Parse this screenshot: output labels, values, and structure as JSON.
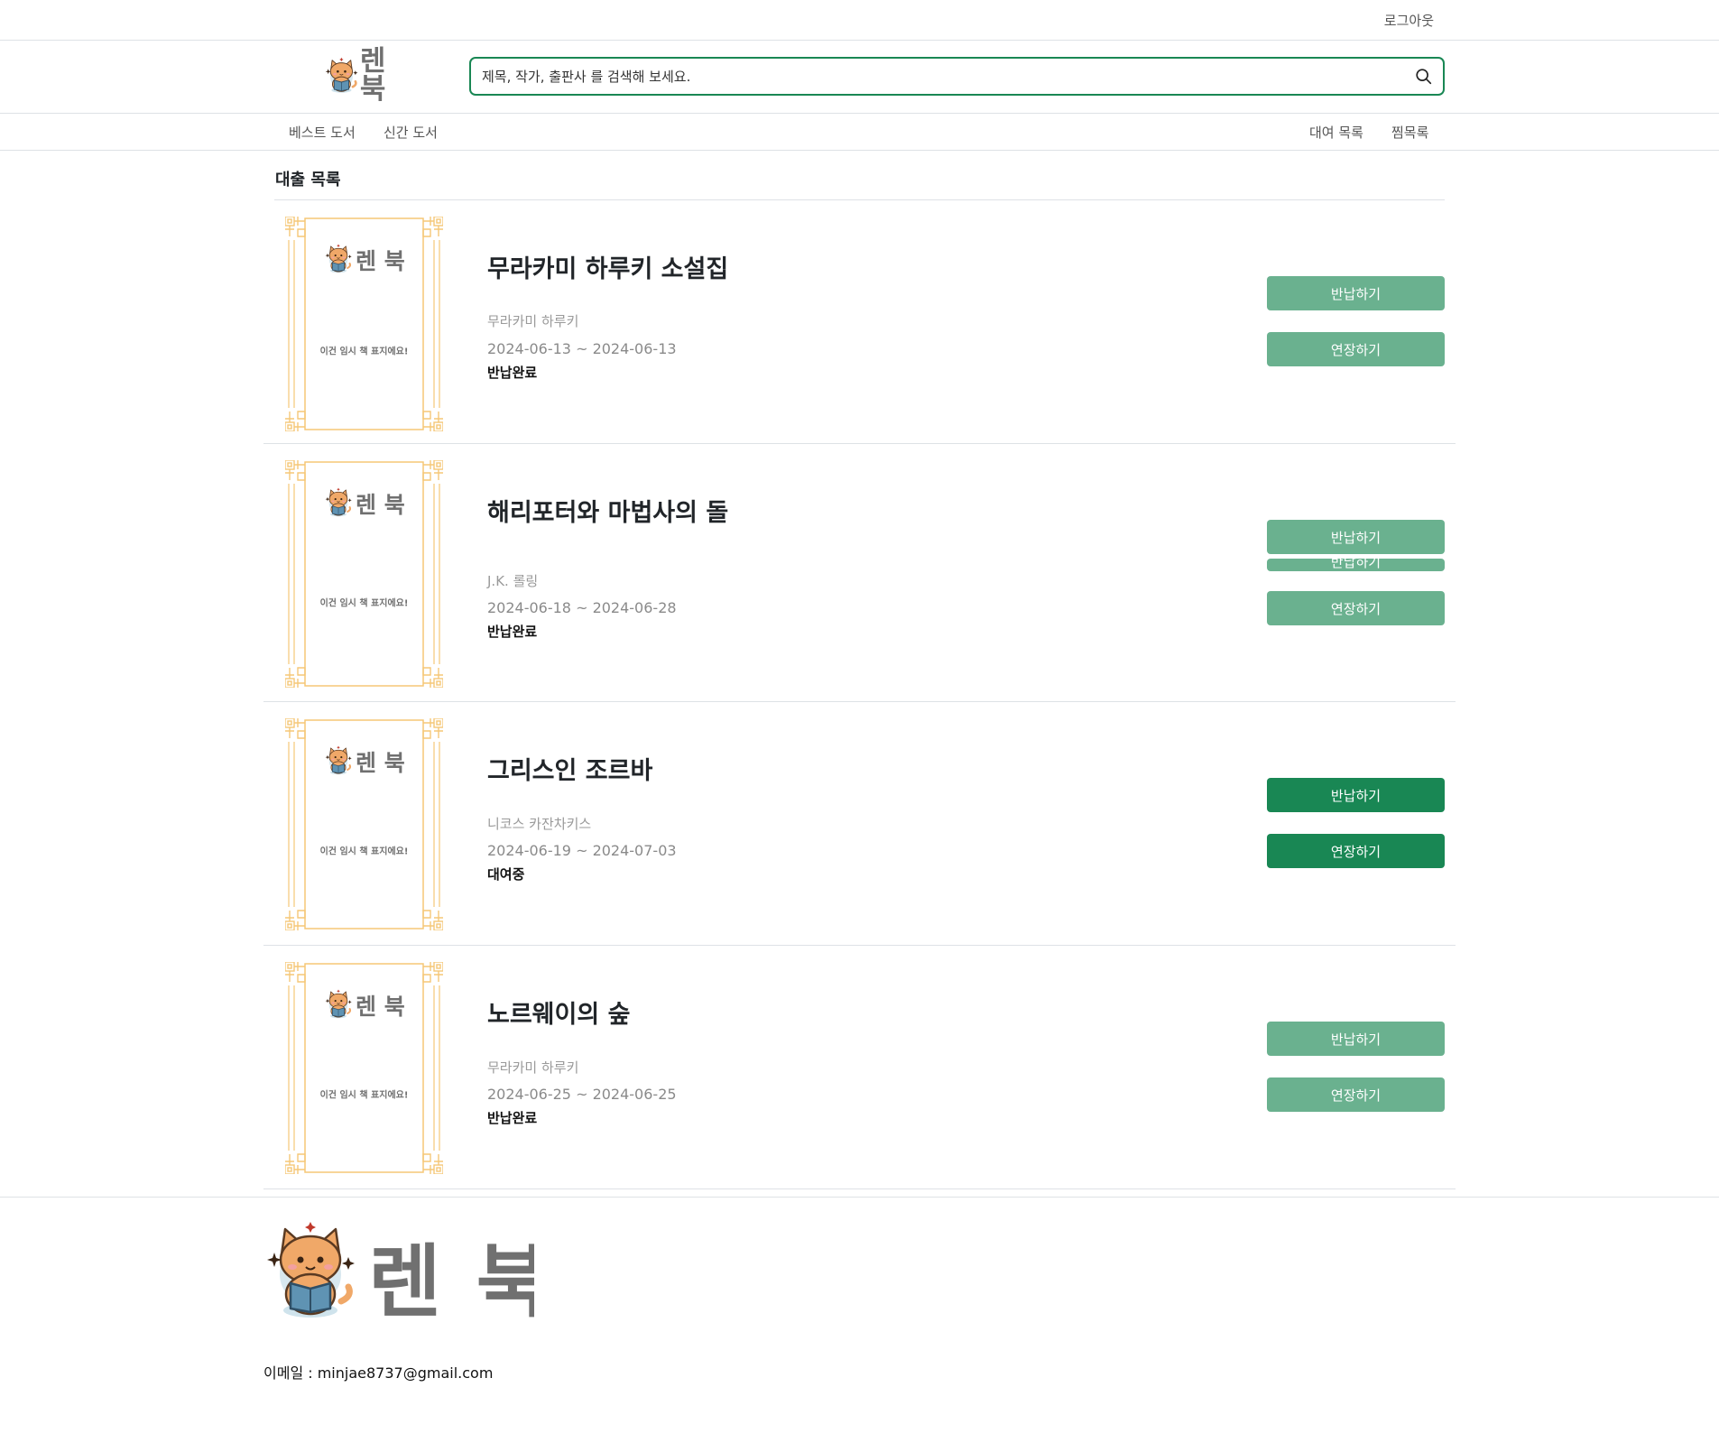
{
  "topbar": {
    "logout_label": "로그아웃"
  },
  "header": {
    "brand_text": "렌 북",
    "search": {
      "placeholder": "제목, 작가, 출판사 를 검색해 보세요.",
      "value": ""
    }
  },
  "nav": {
    "best_books": "베스트 도서",
    "new_books": "신간 도서",
    "rental_list": "대여 목록",
    "wishlist": "찜목록"
  },
  "page": {
    "title": "대출 목록"
  },
  "cover": {
    "brand_text": "렌 북",
    "caption": "이건 임시 책 표지에요!"
  },
  "loans": [
    {
      "title": "무라카미 하루키 소설집",
      "author": "무라카미 하루키",
      "dates": "2024-06-13 ~ 2024-06-13",
      "status": "반납완료",
      "return_label": "반납하기",
      "extend_label": "연장하기"
    },
    {
      "title": "해리포터와 마법사의 돌",
      "author": "J.K. 롤링",
      "dates": "2024-06-18 ~ 2024-06-28",
      "status": "반납완료",
      "return_label": "반납하기",
      "extend_label": "연장하기"
    },
    {
      "title": "그리스인 조르바",
      "author": "니코스 카잔차키스",
      "dates": "2024-06-19 ~ 2024-07-03",
      "status": "대여중",
      "return_label": "반납하기",
      "extend_label": "연장하기"
    },
    {
      "title": "노르웨이의 숲",
      "author": "무라카미 하루키",
      "dates": "2024-06-25 ~ 2024-06-25",
      "status": "반납완료",
      "return_label": "반납하기",
      "extend_label": "연장하기"
    }
  ],
  "footer": {
    "brand_text": "렌 북",
    "email": "이메일 : minjae8737@gmail.com"
  },
  "colors": {
    "accent": "#198754",
    "accent_faded": "#6ab18f",
    "cover_border": "#f5c777",
    "logo_gray": "#707070",
    "cat_orange": "#f0a868"
  }
}
